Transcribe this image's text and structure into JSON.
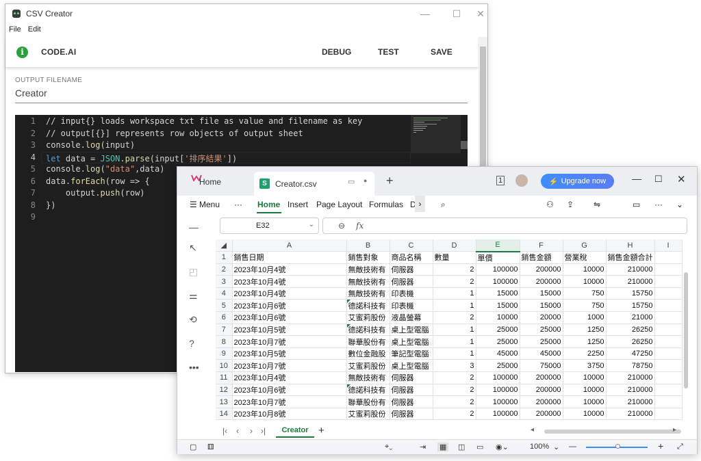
{
  "creator": {
    "title": "CSV Creator",
    "menu": [
      "File",
      "Edit"
    ],
    "brand": "CODE.AI",
    "buttons": {
      "debug": "DEBUG",
      "test": "TEST",
      "save": "SAVE"
    },
    "output_label": "OUTPUT FILENAME",
    "output_value": "Creator",
    "code_lines": [
      "// input{} loads workspace txt file as value and filename as key",
      "// output[{}] represents row objects of output sheet",
      "console.log(input)",
      "let data = JSON.parse(input['排序結果'])",
      "console.log(\"data\",data)",
      "data.forEach(row => {",
      "    output.push(row)",
      "})",
      ""
    ]
  },
  "wps": {
    "tabs": {
      "home": "Home",
      "file": "Creator.csv"
    },
    "upgrade": "Upgrade now",
    "ribbon": {
      "menu": "Menu",
      "more": "···",
      "home": "Home",
      "insert": "Insert",
      "page_layout": "Page Layout",
      "formulas": "Formulas",
      "cut": "D"
    },
    "name_box": "E32",
    "fx": "fx",
    "columns": [
      "A",
      "B",
      "C",
      "D",
      "E",
      "F",
      "G",
      "H",
      "I"
    ],
    "rows": [
      [
        "1",
        "銷售日期",
        "銷售對象",
        "商品名稱",
        "數量",
        "單價",
        "銷售金額",
        "營業稅",
        "銷售金額合計",
        ""
      ],
      [
        "2",
        "2023年10月4號",
        "無敵技術有",
        "伺服器",
        "2",
        "100000",
        "200000",
        "10000",
        "210000",
        ""
      ],
      [
        "3",
        "2023年10月4號",
        "無敵技術有",
        "伺服器",
        "2",
        "100000",
        "200000",
        "10000",
        "210000",
        ""
      ],
      [
        "4",
        "2023年10月4號",
        "無敵技術有",
        "印表機",
        "1",
        "15000",
        "15000",
        "750",
        "15750",
        ""
      ],
      [
        "5",
        "2023年10月6號",
        "德諾科技有",
        "印表機",
        "1",
        "15000",
        "15000",
        "750",
        "15750",
        ""
      ],
      [
        "6",
        "2023年10月6號",
        "艾蜜莉股份",
        "液晶螢幕",
        "2",
        "10000",
        "20000",
        "1000",
        "21000",
        ""
      ],
      [
        "7",
        "2023年10月5號",
        "德諾科技有",
        "桌上型電腦",
        "1",
        "25000",
        "25000",
        "1250",
        "26250",
        ""
      ],
      [
        "8",
        "2023年10月7號",
        "聯華股份有",
        "桌上型電腦",
        "1",
        "25000",
        "25000",
        "1250",
        "26250",
        ""
      ],
      [
        "9",
        "2023年10月5號",
        "數位金融股",
        "筆記型電腦",
        "1",
        "45000",
        "45000",
        "2250",
        "47250",
        ""
      ],
      [
        "10",
        "2023年10月7號",
        "艾蜜莉股份",
        "桌上型電腦",
        "3",
        "25000",
        "75000",
        "3750",
        "78750",
        ""
      ],
      [
        "11",
        "2023年10月4號",
        "無敵技術有",
        "伺服器",
        "2",
        "100000",
        "200000",
        "10000",
        "210000",
        ""
      ],
      [
        "12",
        "2023年10月6號",
        "德諾科技有",
        "伺服器",
        "2",
        "100000",
        "200000",
        "10000",
        "210000",
        ""
      ],
      [
        "13",
        "2023年10月7號",
        "聯華股份有",
        "伺服器",
        "2",
        "100000",
        "200000",
        "10000",
        "210000",
        ""
      ],
      [
        "14",
        "2023年10月8號",
        "艾蜜莉股份",
        "伺服器",
        "2",
        "100000",
        "200000",
        "10000",
        "210000",
        ""
      ]
    ],
    "sheet_name": "Creator",
    "zoom": "100%"
  }
}
